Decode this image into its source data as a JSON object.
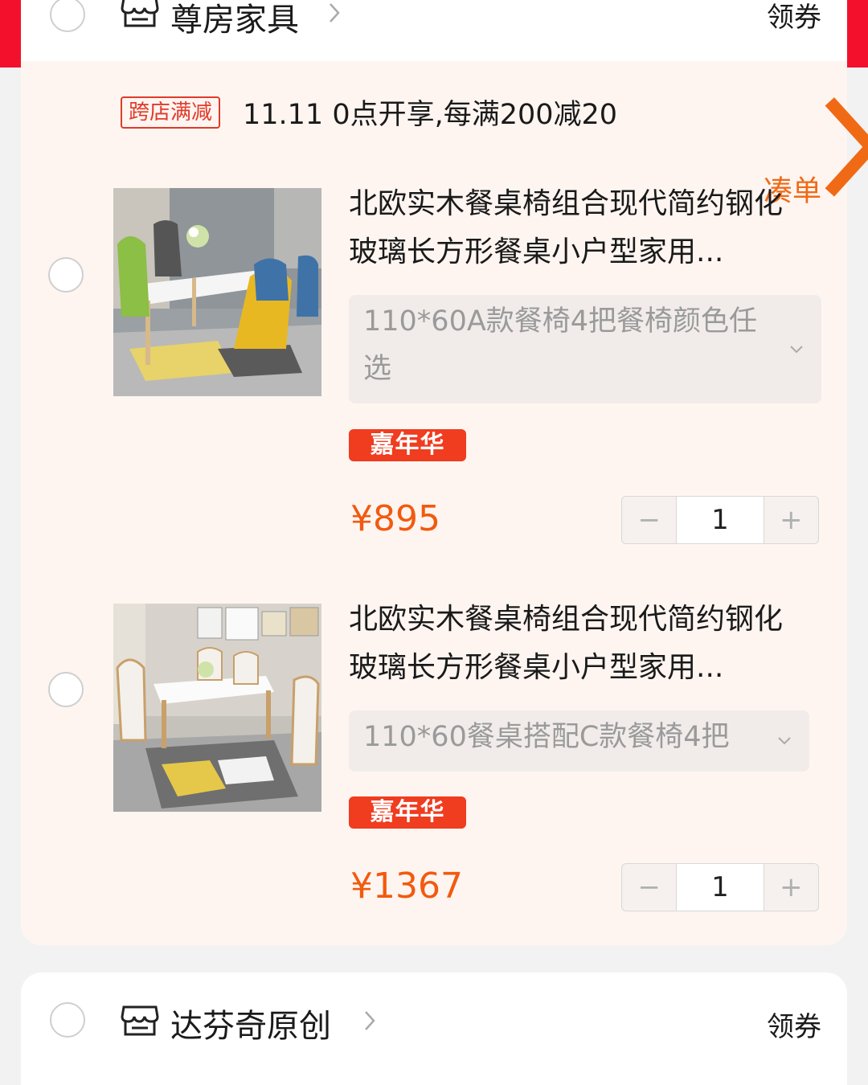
{
  "stores": [
    {
      "name": "尊房家具",
      "coupon_label": "领券",
      "promo": {
        "tag": "跨店满减",
        "text": "11.11 0点开享,每满200减20",
        "link": "凑单"
      },
      "items": [
        {
          "title": "北欧实木餐桌椅组合现代简约钢化玻璃长方形餐桌小户型家用...",
          "spec": "110*60A款餐椅4把餐椅颜色任选",
          "badge": "嘉年华",
          "price": "¥895",
          "quantity": "1"
        },
        {
          "title": "北欧实木餐桌椅组合现代简约钢化玻璃长方形餐桌小户型家用...",
          "spec": "110*60餐桌搭配C款餐椅4把",
          "badge": "嘉年华",
          "price": "¥1367",
          "quantity": "1"
        }
      ]
    },
    {
      "name": "达芬奇原创",
      "coupon_label": "领券"
    }
  ],
  "stepper": {
    "minus": "−",
    "plus": "+"
  },
  "icons": {
    "store": "store-icon",
    "chevron": "chevron-right-icon",
    "dropdown": "chevron-down-icon"
  },
  "colors": {
    "accent_red": "#f2102d",
    "price_orange": "#f25a0f",
    "promo_tag": "#e03a2a",
    "badge_bg": "#f03c1f"
  }
}
